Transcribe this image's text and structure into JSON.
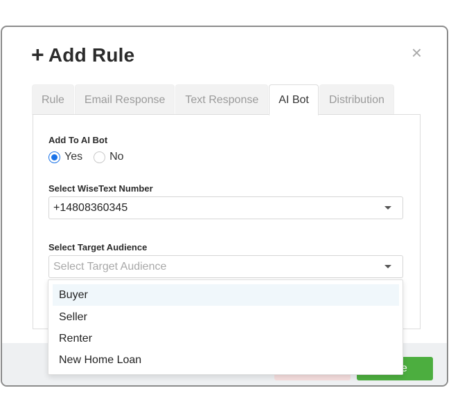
{
  "modal": {
    "title": "Add Rule",
    "close_symbol": "×"
  },
  "tabs": [
    {
      "label": "Rule",
      "active": false
    },
    {
      "label": "Email Response",
      "active": false
    },
    {
      "label": "Text Response",
      "active": false
    },
    {
      "label": "AI Bot",
      "active": true
    },
    {
      "label": "Distribution",
      "active": false
    }
  ],
  "ai_bot": {
    "add_label": "Add To AI Bot",
    "options": [
      {
        "label": "Yes",
        "checked": true
      },
      {
        "label": "No",
        "checked": false
      }
    ],
    "number_label": "Select WiseText Number",
    "number_value": "+14808360345",
    "audience_label": "Select Target Audience",
    "audience_placeholder": "Select Target Audience",
    "audience_options": [
      "Buyer",
      "Seller",
      "Renter",
      "New Home Loan"
    ]
  },
  "footer": {
    "save_partial": "e"
  },
  "colors": {
    "accent": "#1a73e8",
    "save": "#4cae3f",
    "cancel": "#f6dede"
  },
  "icons": [
    "plus-icon",
    "close-icon",
    "chevron-down-icon"
  ]
}
